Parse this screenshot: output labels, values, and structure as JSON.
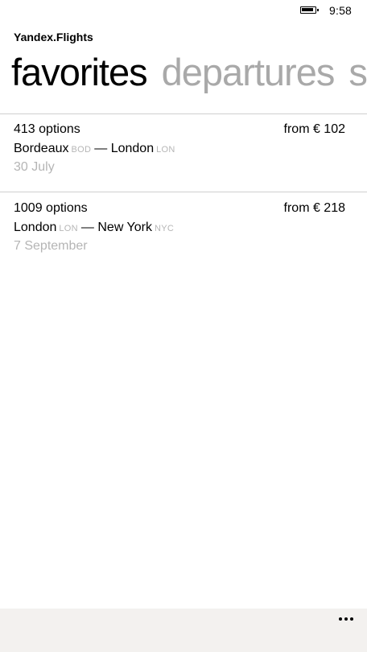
{
  "status_bar": {
    "battery_icon": "battery-icon",
    "time": "9:58"
  },
  "app": {
    "title": "Yandex.Flights"
  },
  "pivot": {
    "items": [
      {
        "label": "favorites",
        "active": true
      },
      {
        "label": "departures",
        "active": false
      },
      {
        "label": "s",
        "active": false
      }
    ]
  },
  "favorites": [
    {
      "options": "413 options",
      "price": "from € 102",
      "from_city": "Bordeaux",
      "from_code": "BOD",
      "separator": "—",
      "to_city": "London",
      "to_code": "LON",
      "date": "30 July"
    },
    {
      "options": "1009 options",
      "price": "from € 218",
      "from_city": "London",
      "from_code": "LON",
      "separator": "—",
      "to_city": "New York",
      "to_code": "NYC",
      "date": "7 September"
    }
  ],
  "app_bar": {
    "more_icon": "more-icon"
  },
  "colors": {
    "inactive_pivot": "#a9a9a9",
    "secondary_text": "#b5b5b5",
    "divider": "#cfcfcf",
    "app_bar_bg": "#f3f1ef"
  }
}
